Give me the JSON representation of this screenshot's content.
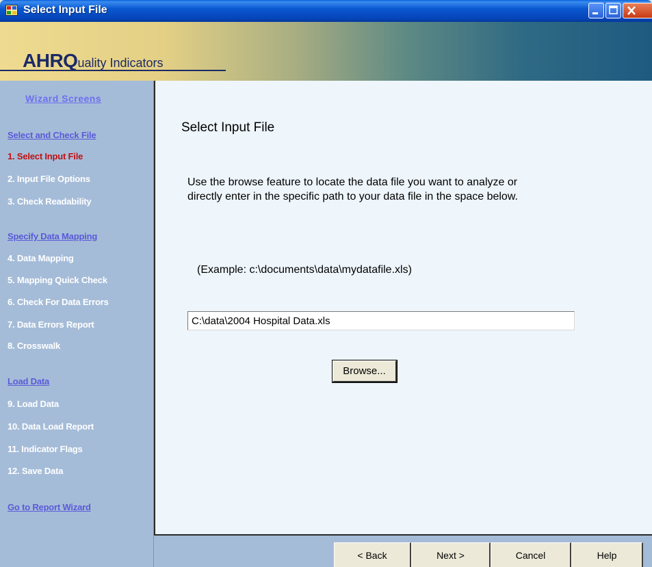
{
  "window": {
    "title": "Select Input File"
  },
  "banner": {
    "logo_main": "AHRQ",
    "logo_rest": "uality Indicators"
  },
  "sidebar": {
    "heading": "Wizard Screens",
    "sections": [
      {
        "title": "Select and Check File",
        "items": [
          "1. Select Input File",
          "2. Input File Options",
          "3. Check Readability"
        ]
      },
      {
        "title": "Specify Data Mapping",
        "items": [
          "4. Data Mapping",
          "5. Mapping Quick Check",
          "6. Check For Data Errors",
          "7. Data Errors Report",
          "8. Crosswalk"
        ]
      },
      {
        "title": "Load Data",
        "items": [
          "9. Load Data",
          "10. Data Load Report",
          "11. Indicator Flags",
          "12. Save Data"
        ]
      }
    ],
    "report_link": "Go to Report Wizard",
    "active_item": "1. Select Input File"
  },
  "main": {
    "title": "Select Input File",
    "instructions_line1": "Use the browse feature to locate the data file you want to analyze or",
    "instructions_line2": "directly enter in the specific path to your data file in the space below.",
    "example": "(Example: c:\\documents\\data\\mydatafile.xls)",
    "file_path": "C:\\data\\2004 Hospital Data.xls",
    "browse_label": "Browse..."
  },
  "footer": {
    "back_label": "< Back",
    "next_label": "Next >",
    "cancel_label": "Cancel",
    "help_label": "Help"
  },
  "colors": {
    "sidebar_bg": "#a5bcd8",
    "active_item": "#c01010",
    "link": "#5a5ad8",
    "main_bg": "#eef5fb",
    "titlebar": "#0a58d0"
  }
}
